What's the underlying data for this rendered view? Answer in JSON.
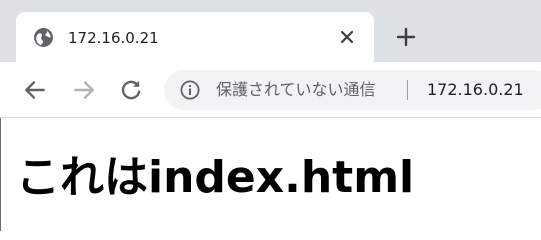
{
  "browser": {
    "tab": {
      "title": "172.16.0.21",
      "favicon": "globe-icon"
    },
    "close_icon": "close-icon",
    "new_tab_icon": "plus-icon",
    "nav": {
      "back_icon": "arrow-left-icon",
      "forward_icon": "arrow-right-icon",
      "reload_icon": "reload-icon"
    },
    "omnibox": {
      "info_icon": "info-icon",
      "security_text": "保護されていない通信",
      "url": "172.16.0.21"
    },
    "colors": {
      "tabstrip": "#dee1e6",
      "icon": "#5f6368",
      "disabled_icon": "#b1b3b6",
      "omnibox": "#f1f3f4"
    }
  },
  "page": {
    "heading": "これはindex.html"
  }
}
